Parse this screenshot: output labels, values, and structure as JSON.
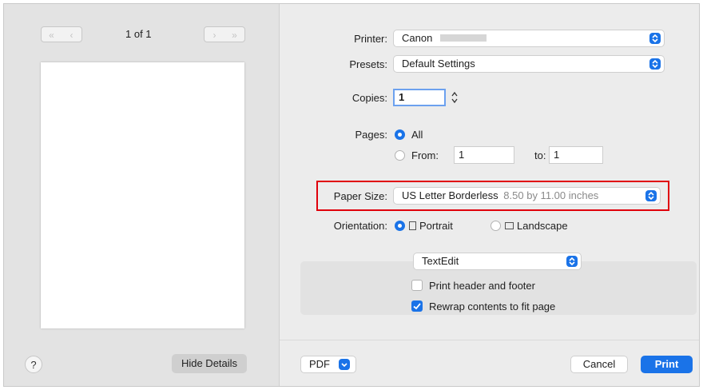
{
  "preview": {
    "page_indicator": "1 of 1",
    "first_prev": [
      "«",
      "‹"
    ],
    "next_last": [
      "›",
      "»"
    ],
    "hide_details_label": "Hide Details",
    "help_label": "?"
  },
  "settings": {
    "printer_label": "Printer:",
    "printer_value": "Canon",
    "presets_label": "Presets:",
    "presets_value": "Default Settings",
    "copies_label": "Copies:",
    "copies_value": "1",
    "pages_label": "Pages:",
    "pages_all_label": "All",
    "pages_from_label": "From:",
    "pages_from_value": "1",
    "pages_to_label": "to:",
    "pages_to_value": "1",
    "paper_size_label": "Paper Size:",
    "paper_size_value": "US Letter Borderless",
    "paper_size_dims": "8.50 by 11.00 inches",
    "orientation_label": "Orientation:",
    "portrait_label": "Portrait",
    "landscape_label": "Landscape",
    "app_section_value": "TextEdit",
    "print_header_footer_label": "Print header and footer",
    "print_header_footer_checked": false,
    "rewrap_label": "Rewrap contents to fit page",
    "rewrap_checked": true
  },
  "footer": {
    "pdf_label": "PDF",
    "cancel_label": "Cancel",
    "print_label": "Print"
  },
  "colors": {
    "accent": "#1a73e8",
    "highlight": "#e0000b"
  }
}
